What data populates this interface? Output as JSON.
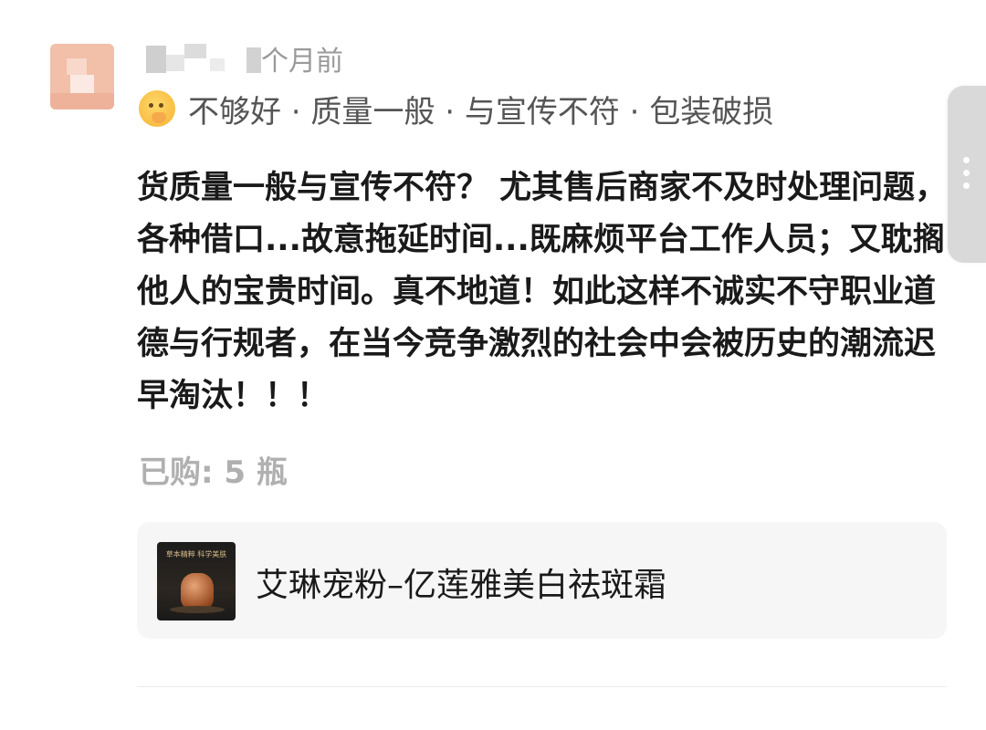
{
  "review": {
    "time_ago": "个月前",
    "tags": "不够好 · 质量一般 · 与宣传不符 · 包装破损",
    "text": "货质量一般与宣传不符？ 尤其售后商家不及时处理问题，各种借口...故意拖延时间...既麻烦平台工作人员；又耽搁他人的宝贵时间。真不地道！如此这样不诚实不守职业道德与行规者，在当今竞争激烈的社会中会被历史的潮流迟早淘汰！！！",
    "purchased": "已购: 5 瓶"
  },
  "product": {
    "name": "艾琳宠粉–亿莲雅美白祛斑霜",
    "thumb_caption": "草本精粹 科学美肤"
  },
  "icons": {
    "rating_emoji": "thinking-face-icon",
    "side_handle": "more-dots-icon"
  },
  "colors": {
    "text_primary": "#1a1a1a",
    "text_secondary": "#555555",
    "text_muted": "#b0b0b0",
    "card_bg": "#f6f6f6"
  }
}
